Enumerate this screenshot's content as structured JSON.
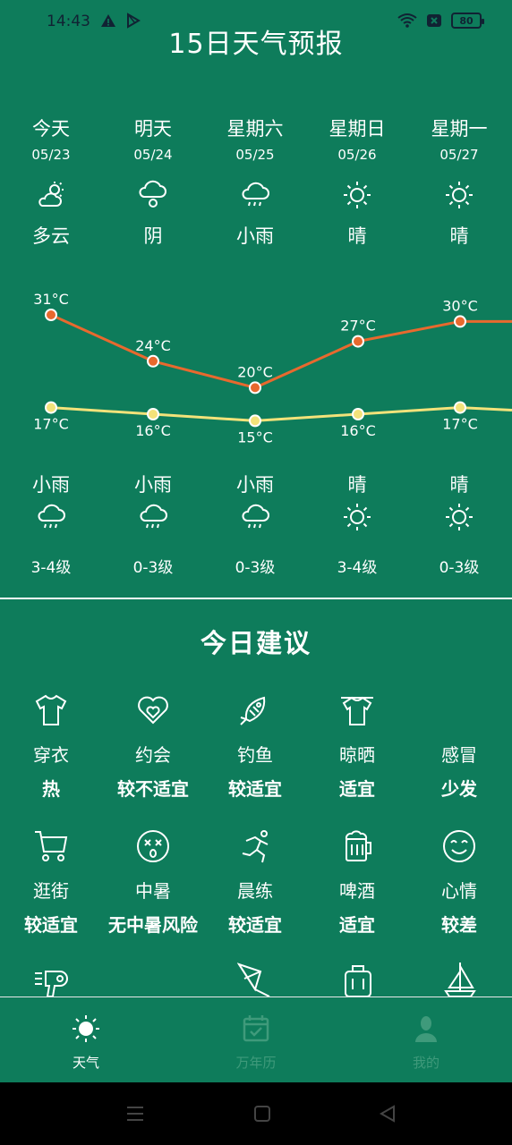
{
  "status": {
    "time": "14:43",
    "battery": "80"
  },
  "title": "15日天气预报",
  "forecast": [
    {
      "day": "今天",
      "date": "05/23",
      "day_weather": "多云",
      "day_icon": "partly-cloudy-icon",
      "high": "31°C",
      "low": "17°C",
      "night_weather": "小雨",
      "night_icon": "rain-icon",
      "wind": "3-4级"
    },
    {
      "day": "明天",
      "date": "05/24",
      "day_weather": "阴",
      "day_icon": "overcast-icon",
      "high": "24°C",
      "low": "16°C",
      "night_weather": "小雨",
      "night_icon": "rain-icon",
      "wind": "0-3级"
    },
    {
      "day": "星期六",
      "date": "05/25",
      "day_weather": "小雨",
      "day_icon": "rain-icon",
      "high": "20°C",
      "low": "15°C",
      "night_weather": "小雨",
      "night_icon": "rain-icon",
      "wind": "0-3级"
    },
    {
      "day": "星期日",
      "date": "05/26",
      "day_weather": "晴",
      "day_icon": "sun-icon",
      "high": "27°C",
      "low": "16°C",
      "night_weather": "晴",
      "night_icon": "sun-icon",
      "wind": "3-4级"
    },
    {
      "day": "星期一",
      "date": "05/27",
      "day_weather": "晴",
      "day_icon": "sun-icon",
      "high": "30°C",
      "low": "17°C",
      "night_weather": "晴",
      "night_icon": "sun-icon",
      "wind": "0-3级"
    }
  ],
  "temps": {
    "high": [
      31,
      24,
      20,
      27,
      30
    ],
    "low": [
      17,
      16,
      15,
      16,
      17
    ],
    "high_color": "#e8692e",
    "low_color": "#f2e27a"
  },
  "advice": {
    "title": "今日建议",
    "items": [
      {
        "name": "穿衣",
        "value": "热",
        "icon": "tshirt-icon"
      },
      {
        "name": "约会",
        "value": "较不适宜",
        "icon": "heart-icon"
      },
      {
        "name": "钓鱼",
        "value": "较适宜",
        "icon": "fish-icon"
      },
      {
        "name": "晾晒",
        "value": "适宜",
        "icon": "drying-shirt-icon"
      },
      {
        "name": "感冒",
        "value": "少发",
        "icon": ""
      },
      {
        "name": "逛街",
        "value": "较适宜",
        "icon": "cart-icon"
      },
      {
        "name": "中暑",
        "value": "无中暑风险",
        "icon": "dizzy-face-icon"
      },
      {
        "name": "晨练",
        "value": "较适宜",
        "icon": "runner-icon"
      },
      {
        "name": "啤酒",
        "value": "适宜",
        "icon": "beer-icon"
      },
      {
        "name": "心情",
        "value": "较差",
        "icon": "smile-icon"
      }
    ],
    "partial_icons": [
      "hairdryer-icon",
      "kite-icon",
      "luggage-icon",
      "sailboat-icon"
    ]
  },
  "nav": {
    "weather": "天气",
    "calendar": "万年历",
    "mine": "我的"
  }
}
